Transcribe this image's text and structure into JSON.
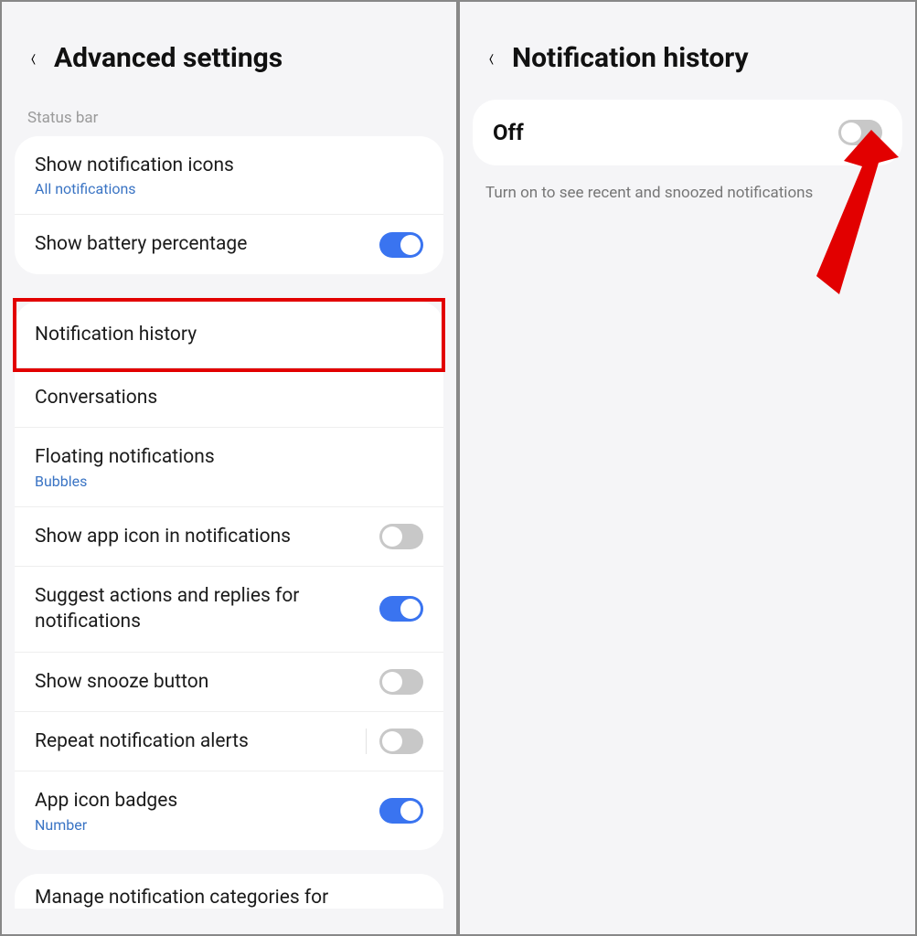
{
  "left": {
    "title": "Advanced settings",
    "section_label": "Status bar",
    "group1": [
      {
        "title": "Show notification icons",
        "sub": "All notifications",
        "toggle": null
      },
      {
        "title": "Show battery percentage",
        "sub": null,
        "toggle": "on"
      }
    ],
    "highlighted": {
      "title": "Notification history"
    },
    "group2": [
      {
        "title": "Conversations",
        "sub": null,
        "toggle": null
      },
      {
        "title": "Floating notifications",
        "sub": "Bubbles",
        "toggle": null
      },
      {
        "title": "Show app icon in notifications",
        "sub": null,
        "toggle": "off"
      },
      {
        "title": "Suggest actions and replies for notifications",
        "sub": null,
        "toggle": "on"
      },
      {
        "title": "Show snooze button",
        "sub": null,
        "toggle": "off"
      },
      {
        "title": "Repeat notification alerts",
        "sub": null,
        "toggle": "off",
        "faded": true
      },
      {
        "title": "App icon badges",
        "sub": "Number",
        "toggle": "on"
      }
    ],
    "cutoff_row": "Manage notification categories for"
  },
  "right": {
    "title": "Notification history",
    "state_label": "Off",
    "toggle": "off",
    "hint": "Turn on to see recent and snoozed notifications"
  }
}
